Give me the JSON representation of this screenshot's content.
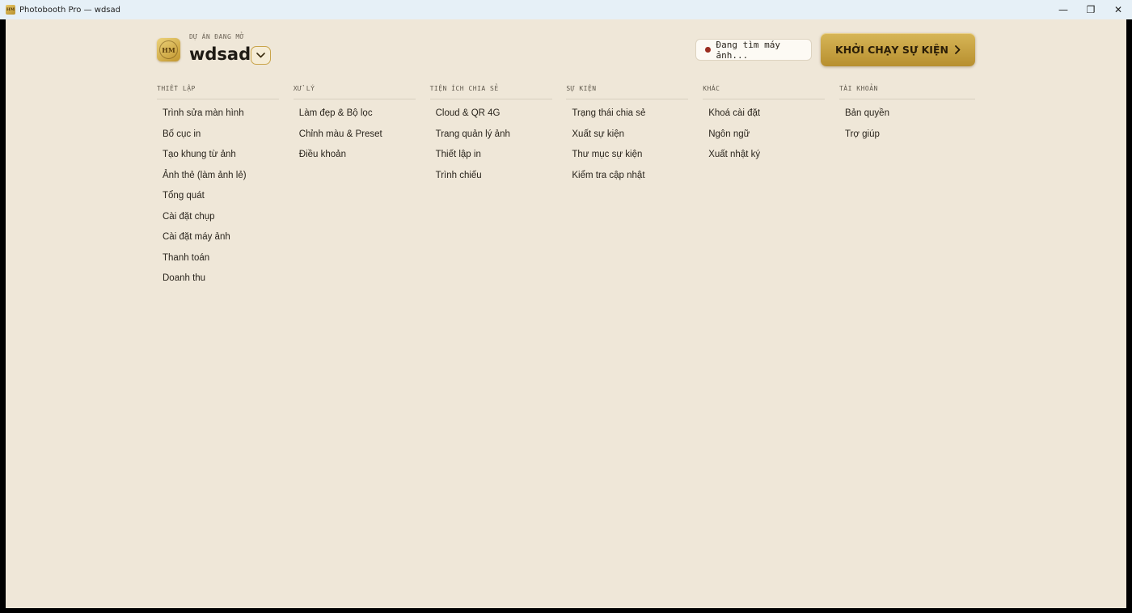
{
  "window": {
    "title": "Photobooth Pro — wdsad",
    "icon_text": "HM",
    "controls": {
      "minimize": "—",
      "restore": "❐",
      "close": "✕"
    }
  },
  "project": {
    "caption": "DỰ ÁN ĐANG MỞ",
    "name": "wdsad",
    "logo_text": "HM"
  },
  "camera_status": {
    "text": "Đang tìm máy ảnh...",
    "color": "#9b2d20"
  },
  "launch_button": {
    "label": "KHỞI CHẠY SỰ KIỆN"
  },
  "menu": {
    "columns": [
      {
        "header": "THIẾT LẬP",
        "items": [
          "Trình sửa màn hình",
          "Bố cục in",
          "Tạo khung từ ảnh",
          "Ảnh thẻ (làm ảnh lẻ)",
          "Tổng quát",
          "Cài đặt chụp",
          "Cài đặt máy ảnh",
          "Thanh toán",
          "Doanh thu"
        ]
      },
      {
        "header": "XỬ LÝ",
        "items": [
          "Làm đẹp & Bộ lọc",
          "Chỉnh màu & Preset",
          "Điều khoản"
        ]
      },
      {
        "header": "TIỆN ÍCH CHIA SẺ",
        "items": [
          "Cloud & QR 4G",
          "Trang quản lý ảnh",
          "Thiết lập in",
          "Trình chiếu"
        ]
      },
      {
        "header": "SỰ KIỆN",
        "items": [
          "Trạng thái chia sẻ",
          "Xuất sự kiện",
          "Thư mục sự kiện",
          "Kiểm tra cập nhật"
        ]
      },
      {
        "header": "KHÁC",
        "items": [
          "Khoá cài đặt",
          "Ngôn ngữ",
          "Xuất nhật ký"
        ]
      },
      {
        "header": "TÀI KHOẢN",
        "items": [
          "Bản quyền",
          "Trợ giúp"
        ]
      }
    ]
  },
  "colors": {
    "background": "#efe7d8",
    "accent_gold": "#c9a44a",
    "text": "#2a251d"
  }
}
